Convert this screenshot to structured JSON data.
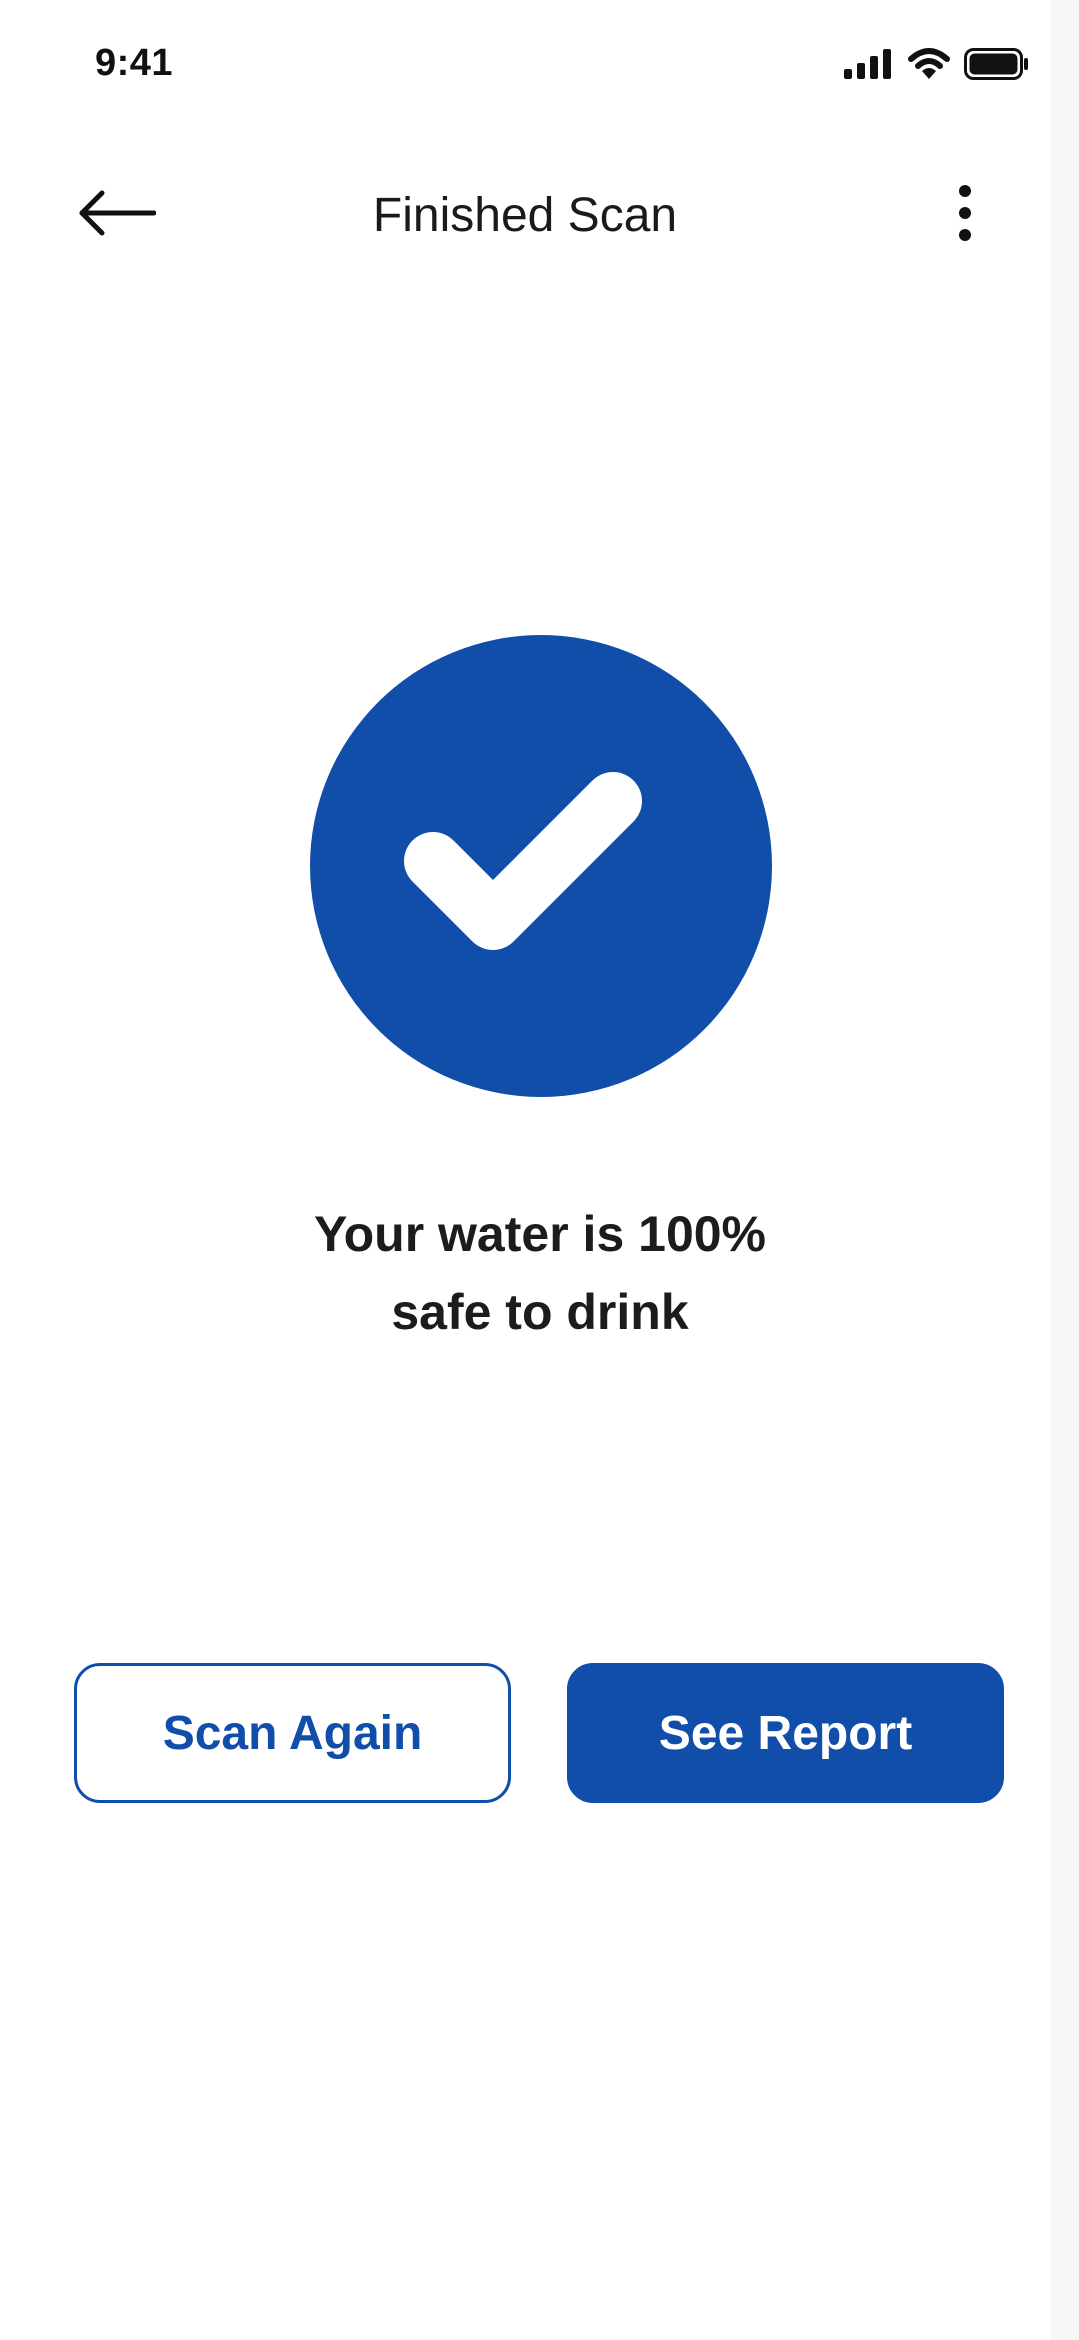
{
  "status_bar": {
    "time": "9:41",
    "icons": [
      "signal-icon",
      "wifi-icon",
      "battery-icon"
    ]
  },
  "header": {
    "title": "Finished Scan",
    "back_icon": "arrow-left-icon",
    "menu_icon": "more-vertical-icon"
  },
  "result": {
    "icon": "check-circle-icon",
    "message_line1": "Your water is 100%",
    "message_line2": "safe to drink"
  },
  "actions": {
    "scan_again_label": "Scan Again",
    "see_report_label": "See Report"
  },
  "colors": {
    "accent": "#104eaa",
    "text": "#1c1c1c",
    "background": "#ffffff"
  }
}
